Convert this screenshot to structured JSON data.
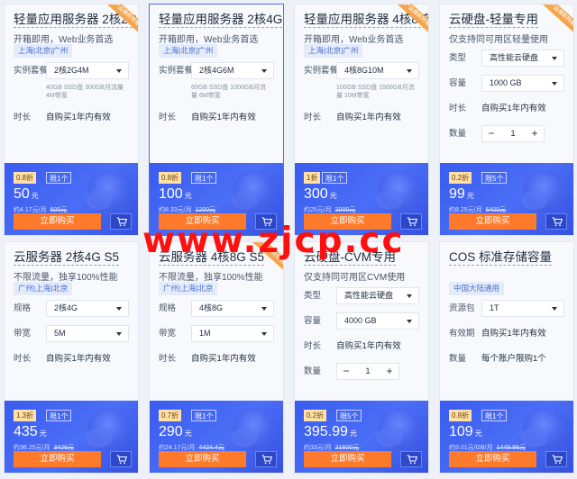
{
  "watermark": "www.zjcp.cc",
  "products": [
    {
      "title": "轻量应用服务器 2核2G",
      "subtitle": "开箱即用，Web业务首选",
      "region": "上海|北京|广州",
      "fields": [
        {
          "label": "实例套餐",
          "type": "select",
          "value": "2核2G4M"
        },
        {
          "type": "note",
          "value": "40GB SSD盘 300GB月流量 4M带宽"
        },
        {
          "label": "时长",
          "type": "text",
          "value": "自购买1年内有效"
        }
      ],
      "discount": "0.8折",
      "limit": "限1个",
      "price": "50",
      "unit": "元",
      "per_month": "约4.17元/月",
      "original": "600元",
      "buy": "立即购买",
      "ribbon": "产品爆款特惠",
      "selected": false
    },
    {
      "title": "轻量应用服务器 2核4G",
      "subtitle": "开箱即用，Web业务首选",
      "region": "上海|北京|广州",
      "fields": [
        {
          "label": "实例套餐",
          "type": "select",
          "value": "2核4G6M"
        },
        {
          "type": "note",
          "value": "60GB SSD盘 1000GB月流量 6M带宽"
        },
        {
          "label": "时长",
          "type": "text",
          "value": "自购买1年内有效"
        }
      ],
      "discount": "0.8折",
      "limit": "限1个",
      "price": "100",
      "unit": "元",
      "per_month": "约8.33元/月",
      "original": "1200元",
      "buy": "立即购买",
      "ribbon": "",
      "selected": true
    },
    {
      "title": "轻量应用服务器 4核8核",
      "subtitle": "开箱即用，Web业务首选",
      "region": "上海|北京|广州",
      "fields": [
        {
          "label": "实例套餐",
          "type": "select",
          "value": "4核8G10M"
        },
        {
          "type": "note",
          "value": "100GB SSD盘 1500GB月流量 10M带宽"
        },
        {
          "label": "时长",
          "type": "text",
          "value": "自购买1年内有效"
        }
      ],
      "discount": "1折",
      "limit": "限1个",
      "price": "300",
      "unit": "元",
      "per_month": "约25元/月",
      "original": "3000元",
      "buy": "立即购买",
      "ribbon": "产品爆款特惠",
      "selected": false
    },
    {
      "title": "云硬盘-轻量专用",
      "subtitle": "仅支持同可用区轻量使用",
      "region": "",
      "fields": [
        {
          "label": "类型",
          "type": "select",
          "value": "高性能云硬盘"
        },
        {
          "label": "容量",
          "type": "select",
          "value": "1000 GB"
        },
        {
          "label": "时长",
          "type": "text",
          "value": "自购买1年内有效"
        },
        {
          "label": "数量",
          "type": "stepper",
          "value": "1"
        }
      ],
      "discount": "0.2折",
      "limit": "限5个",
      "price": "99",
      "unit": "元",
      "per_month": "约8.25元/月",
      "original": "6400元",
      "buy": "立即购买",
      "ribbon": "产品爆款特惠",
      "selected": false
    },
    {
      "title": "云服务器 2核4G S5",
      "subtitle": "不限流量，独享100%性能",
      "region": "广州|上海|北京",
      "fields": [
        {
          "label": "规格",
          "type": "select",
          "value": "2核4G"
        },
        {
          "label": "带宽",
          "type": "select",
          "value": "5M"
        },
        {
          "label": "时长",
          "type": "text",
          "value": "自购买1年内有效"
        }
      ],
      "discount": "1.3折",
      "limit": "限1个",
      "price": "435",
      "unit": "元",
      "per_month": "约36.25元/月",
      "original": "3426元",
      "buy": "立即购买",
      "ribbon": "",
      "selected": false
    },
    {
      "title": "云服务器 4核8G S5",
      "subtitle": "不限流量，独享100%性能",
      "region": "广州|上海|北京",
      "fields": [
        {
          "label": "规格",
          "type": "select",
          "value": "4核8G"
        },
        {
          "label": "带宽",
          "type": "select",
          "value": "1M"
        },
        {
          "label": "时长",
          "type": "text",
          "value": "自购买1年内有效"
        }
      ],
      "discount": "0.7折",
      "limit": "限1个",
      "price": "290",
      "unit": "元",
      "per_month": "约24.17元/月",
      "original": "4424.4元",
      "buy": "立即购买",
      "ribbon": "产品爆款特惠",
      "selected": false
    },
    {
      "title": "云硬盘-CVM专用",
      "subtitle": "仅支持同可用区CVM使用",
      "region": "",
      "fields": [
        {
          "label": "类型",
          "type": "select",
          "value": "高性能云硬盘"
        },
        {
          "label": "容量",
          "type": "select",
          "value": "4000 GB"
        },
        {
          "label": "时长",
          "type": "text",
          "value": "自购买1年内有效"
        },
        {
          "label": "数量",
          "type": "stepper",
          "value": "1"
        }
      ],
      "discount": "0.2折",
      "limit": "限5个",
      "price": "395.99",
      "unit": "元",
      "per_month": "约33元/月",
      "original": "21600元",
      "buy": "立即购买",
      "ribbon": "",
      "selected": false
    },
    {
      "title": "COS 标准存储容量",
      "subtitle": "",
      "region": "中国大陆通用",
      "fields": [
        {
          "label": "资源包",
          "type": "select",
          "value": "1T"
        },
        {
          "label": "有效期",
          "type": "text",
          "value": "自购买1年内有效"
        },
        {
          "label": "数量",
          "type": "text",
          "value": "每个账户限购1个"
        }
      ],
      "discount": "0.8折",
      "limit": "限1个",
      "price": "109",
      "unit": "元",
      "per_month": "约9.01元/GB/月",
      "original": "1449.98元",
      "buy": "立即购买",
      "ribbon": "",
      "selected": false
    }
  ]
}
